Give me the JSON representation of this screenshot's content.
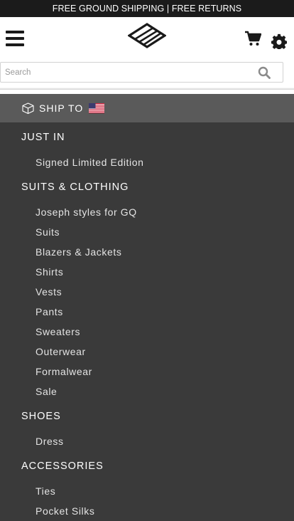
{
  "promo": {
    "text": "FREE GROUND SHIPPING | FREE RETURNS"
  },
  "header": {
    "menu_icon": "hamburger-icon",
    "logo": "brand-logo",
    "cart_icon": "cart-icon",
    "settings_icon": "gear-icon"
  },
  "search": {
    "placeholder": "Search",
    "icon": "search-icon"
  },
  "ship_to": {
    "label": "SHIP TO",
    "icon": "box-icon",
    "flag": "us-flag-icon"
  },
  "menu": {
    "categories": [
      {
        "label": "JUST IN",
        "items": [
          "Signed Limited Edition"
        ]
      },
      {
        "label": "SUITS & CLOTHING",
        "items": [
          "Joseph styles for GQ",
          "Suits",
          "Blazers & Jackets",
          "Shirts",
          "Vests",
          "Pants",
          "Sweaters",
          "Outerwear",
          "Formalwear",
          "Sale"
        ]
      },
      {
        "label": "SHOES",
        "items": [
          "Dress"
        ]
      },
      {
        "label": "ACCESSORIES",
        "items": [
          "Ties",
          "Pocket Silks"
        ]
      }
    ]
  },
  "colors": {
    "promo_bg": "#1b1b1b",
    "menu_bg": "#3a3a3a",
    "shipto_bg": "#5a5a5a",
    "text": "#ffffff"
  }
}
